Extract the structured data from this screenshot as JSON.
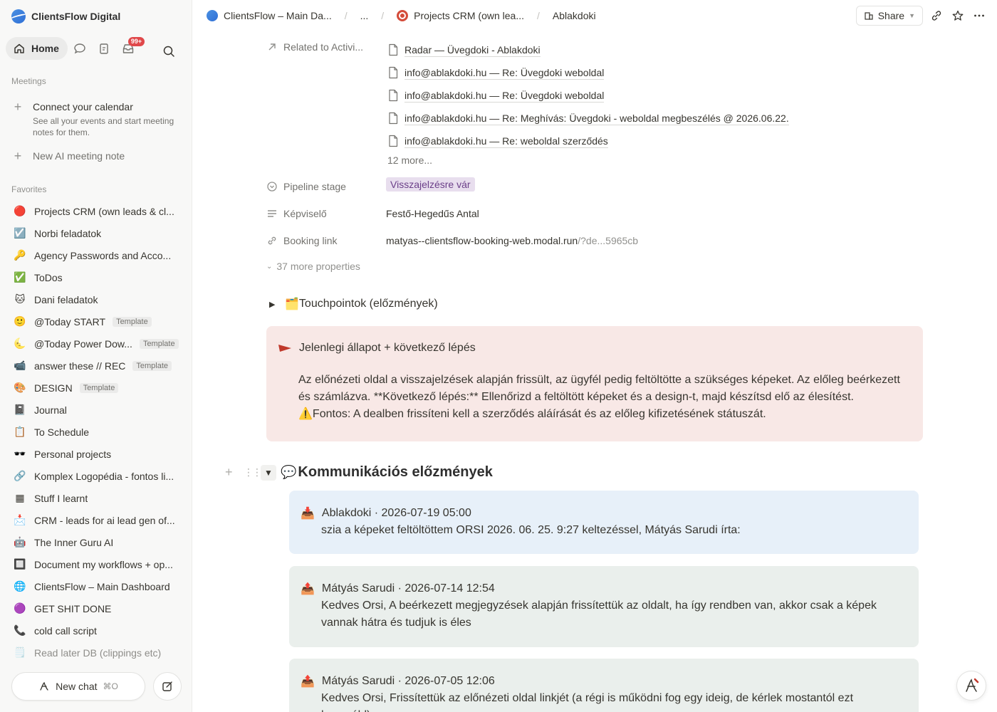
{
  "workspace": {
    "name": "ClientsFlow Digital"
  },
  "nav": {
    "home": "Home",
    "inbox_badge": "99+"
  },
  "meetings": {
    "label": "Meetings",
    "connect_title": "Connect your calendar",
    "connect_sub": "See all your events and start meeting notes for them.",
    "new_note": "New AI meeting note"
  },
  "favorites": {
    "label": "Favorites",
    "items": [
      {
        "icon": "🔴",
        "label": "Projects CRM (own leads & cl...",
        "template": ""
      },
      {
        "icon": "☑️",
        "label": "Norbi feladatok",
        "template": ""
      },
      {
        "icon": "🔑",
        "label": "Agency Passwords and Acco...",
        "template": ""
      },
      {
        "icon": "✅",
        "label": "ToDos",
        "template": ""
      },
      {
        "icon": "🐱",
        "label": "Dani feladatok",
        "template": ""
      },
      {
        "icon": "🙂",
        "label": "@Today START",
        "template": "Template"
      },
      {
        "icon": "🌜",
        "label": "@Today Power Dow...",
        "template": "Template"
      },
      {
        "icon": "📹",
        "label": "answer these // REC",
        "template": "Template"
      },
      {
        "icon": "🎨",
        "label": "DESIGN",
        "template": "Template"
      },
      {
        "icon": "📓",
        "label": "Journal",
        "template": ""
      },
      {
        "icon": "📋",
        "label": "To Schedule",
        "template": ""
      },
      {
        "icon": "🕶️",
        "label": "Personal projects",
        "template": ""
      },
      {
        "icon": "🔗",
        "label": "Komplex Logopédia - fontos li...",
        "template": ""
      },
      {
        "icon": "▦",
        "label": "Stuff I learnt",
        "template": ""
      },
      {
        "icon": "📩",
        "label": "CRM - leads for ai lead gen of...",
        "template": ""
      },
      {
        "icon": "🤖",
        "label": "The Inner Guru AI",
        "template": ""
      },
      {
        "icon": "🔲",
        "label": "Document my workflows + op...",
        "template": ""
      },
      {
        "icon": "🌐",
        "label": "ClientsFlow – Main Dashboard",
        "template": ""
      },
      {
        "icon": "🟣",
        "label": "GET SHIT DONE",
        "template": ""
      },
      {
        "icon": "📞",
        "label": "cold call script",
        "template": ""
      },
      {
        "icon": "🗒️",
        "label": "Read later DB (clippings etc)",
        "template": ""
      }
    ]
  },
  "newchat": {
    "label": "New chat",
    "shortcut": "⌘O"
  },
  "breadcrumb": {
    "c1": "ClientsFlow – Main Da...",
    "c2": "...",
    "c3": "Projects CRM (own lea...",
    "c4": "Ablakdoki"
  },
  "topbar": {
    "share": "Share"
  },
  "props": {
    "related_label": "Related to Activi...",
    "related": [
      "Radar — Üvegdoki - Ablakdoki",
      "info@ablakdoki.hu — Re: Üvegdoki weboldal",
      "info@ablakdoki.hu — Re: Üvegdoki weboldal",
      "info@ablakdoki.hu — Re: Meghívás: Üvegdoki - weboldal megbeszélés @ 2026.06.22.",
      "info@ablakdoki.hu — Re: weboldal szerződés"
    ],
    "related_more": "12 more...",
    "pipeline_label": "Pipeline stage",
    "pipeline_value": "Visszajelzésre vár",
    "rep_label": "Képviselő",
    "rep_value": "Festő-Hegedűs Antal",
    "booking_label": "Booking link",
    "booking_value": "matyas--clientsflow-booking-web.modal.run",
    "booking_tail": "/?de...5965cb",
    "more_props": "37 more properties"
  },
  "touchpoints": {
    "icon": "🗂️",
    "label": "Touchpointok (előzmények)"
  },
  "callout": {
    "title": "Jelenlegi állapot + következő lépés",
    "body": "Az előnézeti oldal a visszajelzések alapján frissült, az ügyfél pedig feltöltötte a szükséges képeket. Az előleg beérkezett és számlázva. **Következő lépés:** Ellenőrizd a feltöltött képeket és a design-t, majd készítsd elő az élesítést. ⚠️Fontos: A dealben frissíteni kell a szerződés aláírását és az előleg kifizetésének státuszát."
  },
  "comms": {
    "icon": "💬",
    "title": "Kommunikációs előzmények",
    "messages": [
      {
        "meta": "Ablakdoki · 2026-07-19 05:00",
        "text": "szia a képeket feltöltöttem ORSI 2026. 06. 25. 9:27 keltezéssel, Mátyás Sarudi írta:"
      },
      {
        "meta": "Mátyás Sarudi · 2026-07-14 12:54",
        "text": "Kedves Orsi, A beérkezett megjegyzések alapján frissítettük az oldalt, ha így rendben van, akkor csak a képek vannak hátra és tudjuk is éles"
      },
      {
        "meta": "Mátyás Sarudi · 2026-07-05 12:06",
        "text": "Kedves Orsi, Frissítettük az előnézeti oldal linkjét (a régi is működni fog egy ideig, de kérlek mostantól ezt használd):"
      }
    ]
  }
}
